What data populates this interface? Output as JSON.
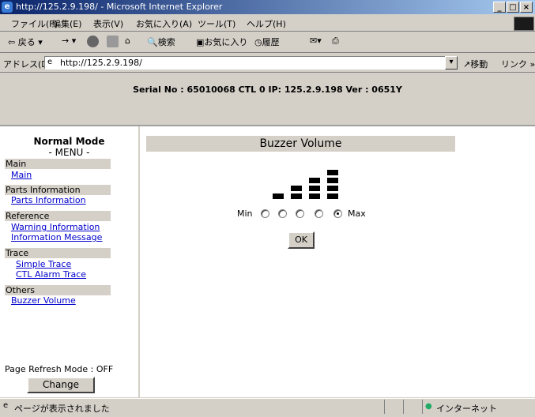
{
  "window": {
    "title": "http://125.2.9.198/ - Microsoft Internet Explorer"
  },
  "menubar": {
    "items": [
      "ファイル(F)",
      "編集(E)",
      "表示(V)",
      "お気に入り(A)",
      "ツール(T)",
      "ヘルプ(H)"
    ]
  },
  "toolbar": {
    "back": "戻る",
    "search": "検索",
    "favorites": "お気に入り",
    "history": "履歴"
  },
  "addressbar": {
    "label": "アドレス(D)",
    "url": "http://125.2.9.198/",
    "go": "移動",
    "links": "リンク »"
  },
  "header": {
    "serial": "Serial No : 65010068  CTL 0  IP: 125.2.9.198  Ver : 0651Y"
  },
  "sidebar": {
    "mode": "Normal Mode",
    "menu_title": "- MENU -",
    "sections": [
      {
        "title": "Main",
        "links": [
          "Main"
        ]
      },
      {
        "title": "Parts Information",
        "links": [
          "Parts Information"
        ]
      },
      {
        "title": "Reference",
        "links": [
          "Warning Information",
          "Information Message"
        ]
      },
      {
        "title": "Trace",
        "links": [
          "Simple Trace",
          "CTL Alarm Trace"
        ]
      },
      {
        "title": "Others",
        "links": [
          "Buzzer Volume"
        ]
      }
    ],
    "refresh_label": "Page Refresh Mode : OFF",
    "change_button": "Change"
  },
  "main": {
    "title": "Buzzer Volume",
    "min_label": "Min",
    "max_label": "Max",
    "volume_levels": 5,
    "selected_level": 5,
    "ok_button": "OK"
  },
  "status": {
    "text": "ページが表示されました",
    "zone": "インターネット"
  }
}
